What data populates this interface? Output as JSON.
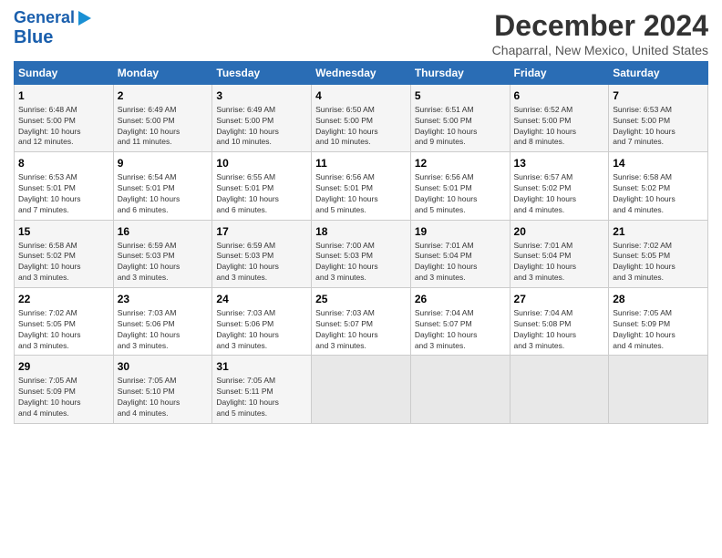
{
  "header": {
    "logo_line1": "General",
    "logo_line2": "Blue",
    "title": "December 2024",
    "subtitle": "Chaparral, New Mexico, United States"
  },
  "columns": [
    "Sunday",
    "Monday",
    "Tuesday",
    "Wednesday",
    "Thursday",
    "Friday",
    "Saturday"
  ],
  "weeks": [
    [
      {
        "day": "1",
        "lines": [
          "Sunrise: 6:48 AM",
          "Sunset: 5:00 PM",
          "Daylight: 10 hours",
          "and 12 minutes."
        ]
      },
      {
        "day": "2",
        "lines": [
          "Sunrise: 6:49 AM",
          "Sunset: 5:00 PM",
          "Daylight: 10 hours",
          "and 11 minutes."
        ]
      },
      {
        "day": "3",
        "lines": [
          "Sunrise: 6:49 AM",
          "Sunset: 5:00 PM",
          "Daylight: 10 hours",
          "and 10 minutes."
        ]
      },
      {
        "day": "4",
        "lines": [
          "Sunrise: 6:50 AM",
          "Sunset: 5:00 PM",
          "Daylight: 10 hours",
          "and 10 minutes."
        ]
      },
      {
        "day": "5",
        "lines": [
          "Sunrise: 6:51 AM",
          "Sunset: 5:00 PM",
          "Daylight: 10 hours",
          "and 9 minutes."
        ]
      },
      {
        "day": "6",
        "lines": [
          "Sunrise: 6:52 AM",
          "Sunset: 5:00 PM",
          "Daylight: 10 hours",
          "and 8 minutes."
        ]
      },
      {
        "day": "7",
        "lines": [
          "Sunrise: 6:53 AM",
          "Sunset: 5:00 PM",
          "Daylight: 10 hours",
          "and 7 minutes."
        ]
      }
    ],
    [
      {
        "day": "8",
        "lines": [
          "Sunrise: 6:53 AM",
          "Sunset: 5:01 PM",
          "Daylight: 10 hours",
          "and 7 minutes."
        ]
      },
      {
        "day": "9",
        "lines": [
          "Sunrise: 6:54 AM",
          "Sunset: 5:01 PM",
          "Daylight: 10 hours",
          "and 6 minutes."
        ]
      },
      {
        "day": "10",
        "lines": [
          "Sunrise: 6:55 AM",
          "Sunset: 5:01 PM",
          "Daylight: 10 hours",
          "and 6 minutes."
        ]
      },
      {
        "day": "11",
        "lines": [
          "Sunrise: 6:56 AM",
          "Sunset: 5:01 PM",
          "Daylight: 10 hours",
          "and 5 minutes."
        ]
      },
      {
        "day": "12",
        "lines": [
          "Sunrise: 6:56 AM",
          "Sunset: 5:01 PM",
          "Daylight: 10 hours",
          "and 5 minutes."
        ]
      },
      {
        "day": "13",
        "lines": [
          "Sunrise: 6:57 AM",
          "Sunset: 5:02 PM",
          "Daylight: 10 hours",
          "and 4 minutes."
        ]
      },
      {
        "day": "14",
        "lines": [
          "Sunrise: 6:58 AM",
          "Sunset: 5:02 PM",
          "Daylight: 10 hours",
          "and 4 minutes."
        ]
      }
    ],
    [
      {
        "day": "15",
        "lines": [
          "Sunrise: 6:58 AM",
          "Sunset: 5:02 PM",
          "Daylight: 10 hours",
          "and 3 minutes."
        ]
      },
      {
        "day": "16",
        "lines": [
          "Sunrise: 6:59 AM",
          "Sunset: 5:03 PM",
          "Daylight: 10 hours",
          "and 3 minutes."
        ]
      },
      {
        "day": "17",
        "lines": [
          "Sunrise: 6:59 AM",
          "Sunset: 5:03 PM",
          "Daylight: 10 hours",
          "and 3 minutes."
        ]
      },
      {
        "day": "18",
        "lines": [
          "Sunrise: 7:00 AM",
          "Sunset: 5:03 PM",
          "Daylight: 10 hours",
          "and 3 minutes."
        ]
      },
      {
        "day": "19",
        "lines": [
          "Sunrise: 7:01 AM",
          "Sunset: 5:04 PM",
          "Daylight: 10 hours",
          "and 3 minutes."
        ]
      },
      {
        "day": "20",
        "lines": [
          "Sunrise: 7:01 AM",
          "Sunset: 5:04 PM",
          "Daylight: 10 hours",
          "and 3 minutes."
        ]
      },
      {
        "day": "21",
        "lines": [
          "Sunrise: 7:02 AM",
          "Sunset: 5:05 PM",
          "Daylight: 10 hours",
          "and 3 minutes."
        ]
      }
    ],
    [
      {
        "day": "22",
        "lines": [
          "Sunrise: 7:02 AM",
          "Sunset: 5:05 PM",
          "Daylight: 10 hours",
          "and 3 minutes."
        ]
      },
      {
        "day": "23",
        "lines": [
          "Sunrise: 7:03 AM",
          "Sunset: 5:06 PM",
          "Daylight: 10 hours",
          "and 3 minutes."
        ]
      },
      {
        "day": "24",
        "lines": [
          "Sunrise: 7:03 AM",
          "Sunset: 5:06 PM",
          "Daylight: 10 hours",
          "and 3 minutes."
        ]
      },
      {
        "day": "25",
        "lines": [
          "Sunrise: 7:03 AM",
          "Sunset: 5:07 PM",
          "Daylight: 10 hours",
          "and 3 minutes."
        ]
      },
      {
        "day": "26",
        "lines": [
          "Sunrise: 7:04 AM",
          "Sunset: 5:07 PM",
          "Daylight: 10 hours",
          "and 3 minutes."
        ]
      },
      {
        "day": "27",
        "lines": [
          "Sunrise: 7:04 AM",
          "Sunset: 5:08 PM",
          "Daylight: 10 hours",
          "and 3 minutes."
        ]
      },
      {
        "day": "28",
        "lines": [
          "Sunrise: 7:05 AM",
          "Sunset: 5:09 PM",
          "Daylight: 10 hours",
          "and 4 minutes."
        ]
      }
    ],
    [
      {
        "day": "29",
        "lines": [
          "Sunrise: 7:05 AM",
          "Sunset: 5:09 PM",
          "Daylight: 10 hours",
          "and 4 minutes."
        ]
      },
      {
        "day": "30",
        "lines": [
          "Sunrise: 7:05 AM",
          "Sunset: 5:10 PM",
          "Daylight: 10 hours",
          "and 4 minutes."
        ]
      },
      {
        "day": "31",
        "lines": [
          "Sunrise: 7:05 AM",
          "Sunset: 5:11 PM",
          "Daylight: 10 hours",
          "and 5 minutes."
        ]
      },
      null,
      null,
      null,
      null
    ]
  ]
}
